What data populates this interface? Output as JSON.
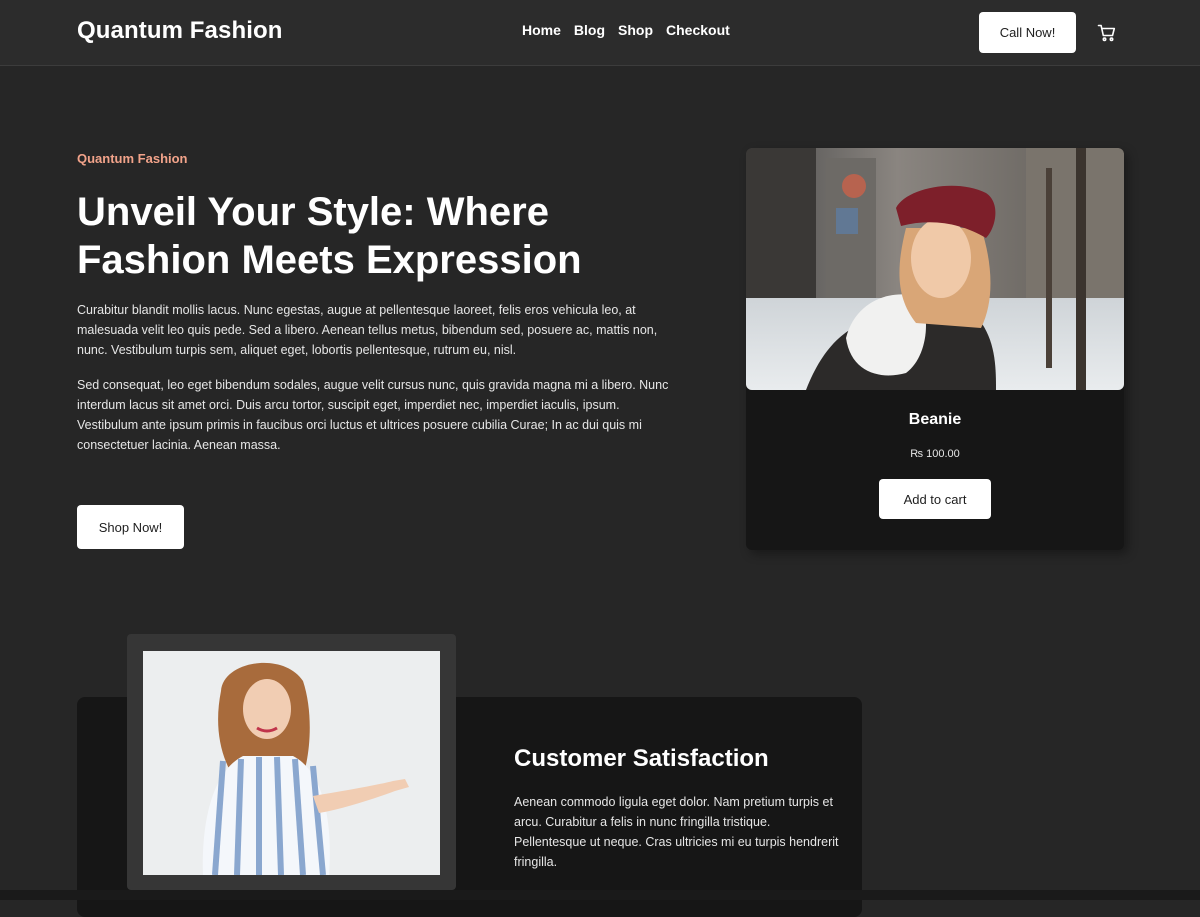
{
  "header": {
    "brand": "Quantum Fashion",
    "nav": [
      "Home",
      "Blog",
      "Shop",
      "Checkout"
    ],
    "call_label": "Call Now!",
    "cart_icon": "cart-icon"
  },
  "hero": {
    "eyebrow": "Quantum Fashion",
    "title": "Unveil Your Style: Where Fashion Meets Expression",
    "paragraph1": "Curabitur blandit mollis lacus. Nunc egestas, augue at pellentesque laoreet, felis eros vehicula leo, at malesuada velit leo quis pede. Sed a libero. Aenean tellus metus, bibendum sed, posuere ac, mattis non, nunc. Vestibulum turpis sem, aliquet eget, lobortis pellentesque, rutrum eu, nisl.",
    "paragraph2": "Sed consequat, leo eget bibendum sodales, augue velit cursus nunc, quis gravida magna mi a libero. Nunc interdum lacus sit amet orci. Duis arcu tortor, suscipit eget, imperdiet nec, imperdiet iaculis, ipsum. Vestibulum ante ipsum primis in faucibus orci luctus et ultrices posuere cubilia Curae; In ac dui quis mi consectetuer lacinia. Aenean massa.",
    "shop_label": "Shop Now!"
  },
  "product": {
    "name": "Beanie",
    "price": "₨ 100.00",
    "add_label": "Add to cart"
  },
  "satisfaction": {
    "title": "Customer Satisfaction",
    "text": "Aenean commodo ligula eget dolor. Nam pretium turpis et arcu. Curabitur a felis in nunc fringilla tristique. Pellentesque ut neque. Cras ultricies mi eu turpis hendrerit fringilla."
  },
  "colors": {
    "background": "#262626",
    "header": "#2c2c2c",
    "accent": "#f2a38a",
    "card": "#161616"
  }
}
